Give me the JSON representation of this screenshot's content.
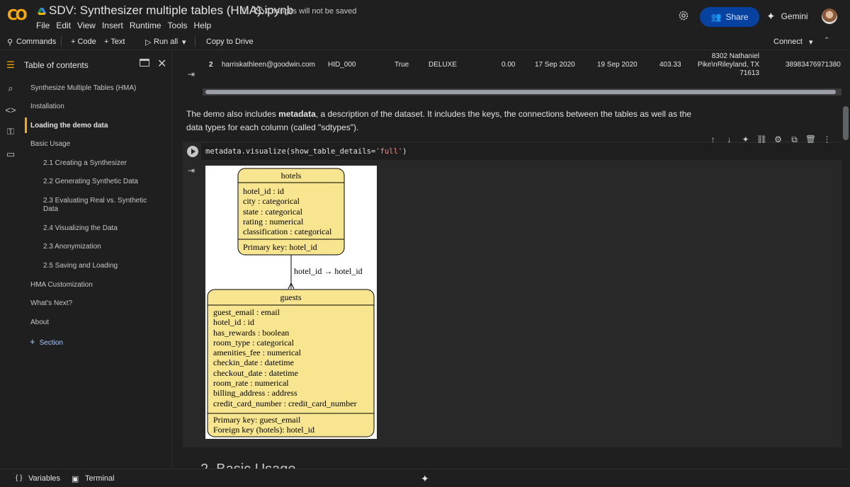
{
  "app": {
    "notebook_title": "SDV: Synthesizer multiple tables (HMA).ipynb",
    "save_status": "Changes will not be saved",
    "menu": [
      "File",
      "Edit",
      "View",
      "Insert",
      "Runtime",
      "Tools",
      "Help"
    ],
    "share_label": "Share",
    "gemini_label": "Gemini"
  },
  "toolbar": {
    "commands": "Commands",
    "code": "+ Code",
    "text": "+ Text",
    "run_all": "Run all",
    "copy_to_drive": "Copy to Drive",
    "connect": "Connect"
  },
  "sidebar": {
    "title": "Table of contents",
    "items": [
      {
        "label": "Synthesize Multiple Tables (HMA)"
      },
      {
        "label": "Installation"
      },
      {
        "label": "Loading the demo data"
      },
      {
        "label": "Basic Usage"
      },
      {
        "label": "2.1 Creating a Synthesizer"
      },
      {
        "label": "2.2 Generating Synthetic Data"
      },
      {
        "label": "2.3 Evaluating Real vs. Synthetic Data"
      },
      {
        "label": "2.4 Visualizing the Data"
      },
      {
        "label": "2.3 Anonymization"
      },
      {
        "label": "2.5 Saving and Loading"
      },
      {
        "label": "HMA Customization"
      },
      {
        "label": "What's Next?"
      },
      {
        "label": "About"
      }
    ],
    "add_section": "Section"
  },
  "table_row": {
    "index": "2",
    "email": "harriskathleen@goodwin.com",
    "hotel_id": "HID_000",
    "has_rewards": "True",
    "room_type": "DELUXE",
    "amenities_fee": "0.00",
    "checkin_date": "17 Sep 2020",
    "checkout_date": "19 Sep 2020",
    "room_rate": "403.33",
    "billing_address_1": "8302 Nathaniel",
    "billing_address_2": "Pike\\nRileyland, TX",
    "billing_address_3": "71613",
    "credit_card_number": "38983476971380"
  },
  "text_cell": {
    "before": "The demo also includes ",
    "bold": "metadata",
    "after": ", a description of the dataset. It includes the keys, the connections between the tables as well as the data types for each column (called \"sdtypes\")."
  },
  "code_cell": {
    "code_prefix": "metadata.visualize(show_table_details=",
    "code_string": "'full'",
    "code_suffix": ")"
  },
  "diagram": {
    "hotels": {
      "name": "hotels",
      "fields": [
        "hotel_id : id",
        "city : categorical",
        "state : categorical",
        "rating : numerical",
        "classification : categorical"
      ],
      "keys": [
        "Primary key: hotel_id"
      ]
    },
    "edge_label": "hotel_id → hotel_id",
    "guests": {
      "name": "guests",
      "fields": [
        "guest_email : email",
        "hotel_id : id",
        "has_rewards : boolean",
        "room_type : categorical",
        "amenities_fee : numerical",
        "checkin_date : datetime",
        "checkout_date : datetime",
        "room_rate : numerical",
        "billing_address : address",
        "credit_card_number : credit_card_number"
      ],
      "keys": [
        "Primary key: guest_email",
        "Foreign key (hotels): hotel_id"
      ]
    }
  },
  "next_heading": "2. Basic Usage",
  "statusbar": {
    "variables": "Variables",
    "terminal": "Terminal"
  },
  "colors": {
    "accent": "#f9ab00",
    "share_bg": "#0842a0",
    "node_fill": "#f7e68f"
  }
}
